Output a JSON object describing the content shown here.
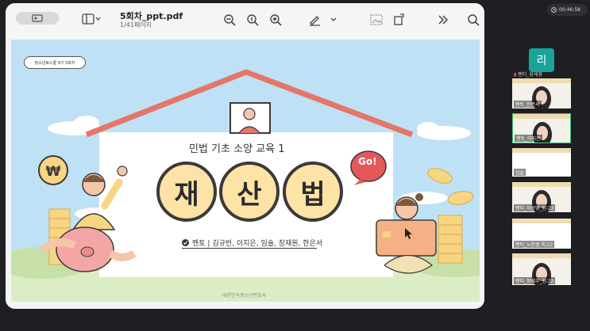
{
  "pdf_viewer": {
    "doc_title": "5회차_ppt.pdf",
    "page_indicator": "1/41페이지"
  },
  "slide": {
    "badge": "청소년로스쿨 9기 5회차",
    "subtitle": "민법 기초 소양 교육 1",
    "title_chars": [
      "재",
      "산",
      "법"
    ],
    "mentors": "멘토 | 김규빈, 이지은, 임솔, 장재원, 한은서",
    "go_text": "Go!",
    "coin_symbol": "₩",
    "footer": "대한민국청소년변호사"
  },
  "meeting": {
    "time": "00:46:58",
    "avatar_letter": "리",
    "host_label": "멘티_성세경",
    "participants": [
      {
        "label": "멘토_한은서"
      },
      {
        "label": "멘토_이지은"
      },
      {
        "label": "임솔"
      },
      {
        "label": "멘티_이선영_원고3"
      },
      {
        "label": "멘티_노윤범 피고2"
      },
      {
        "label": "멘티_정재우_원고2"
      }
    ]
  },
  "colors": {
    "roof": "#e4766a",
    "slide_bg": "#bfe1f5",
    "circle_fill": "#fde3a6",
    "accent_teal": "#1aa39b",
    "go_bubble": "#e4585a"
  }
}
